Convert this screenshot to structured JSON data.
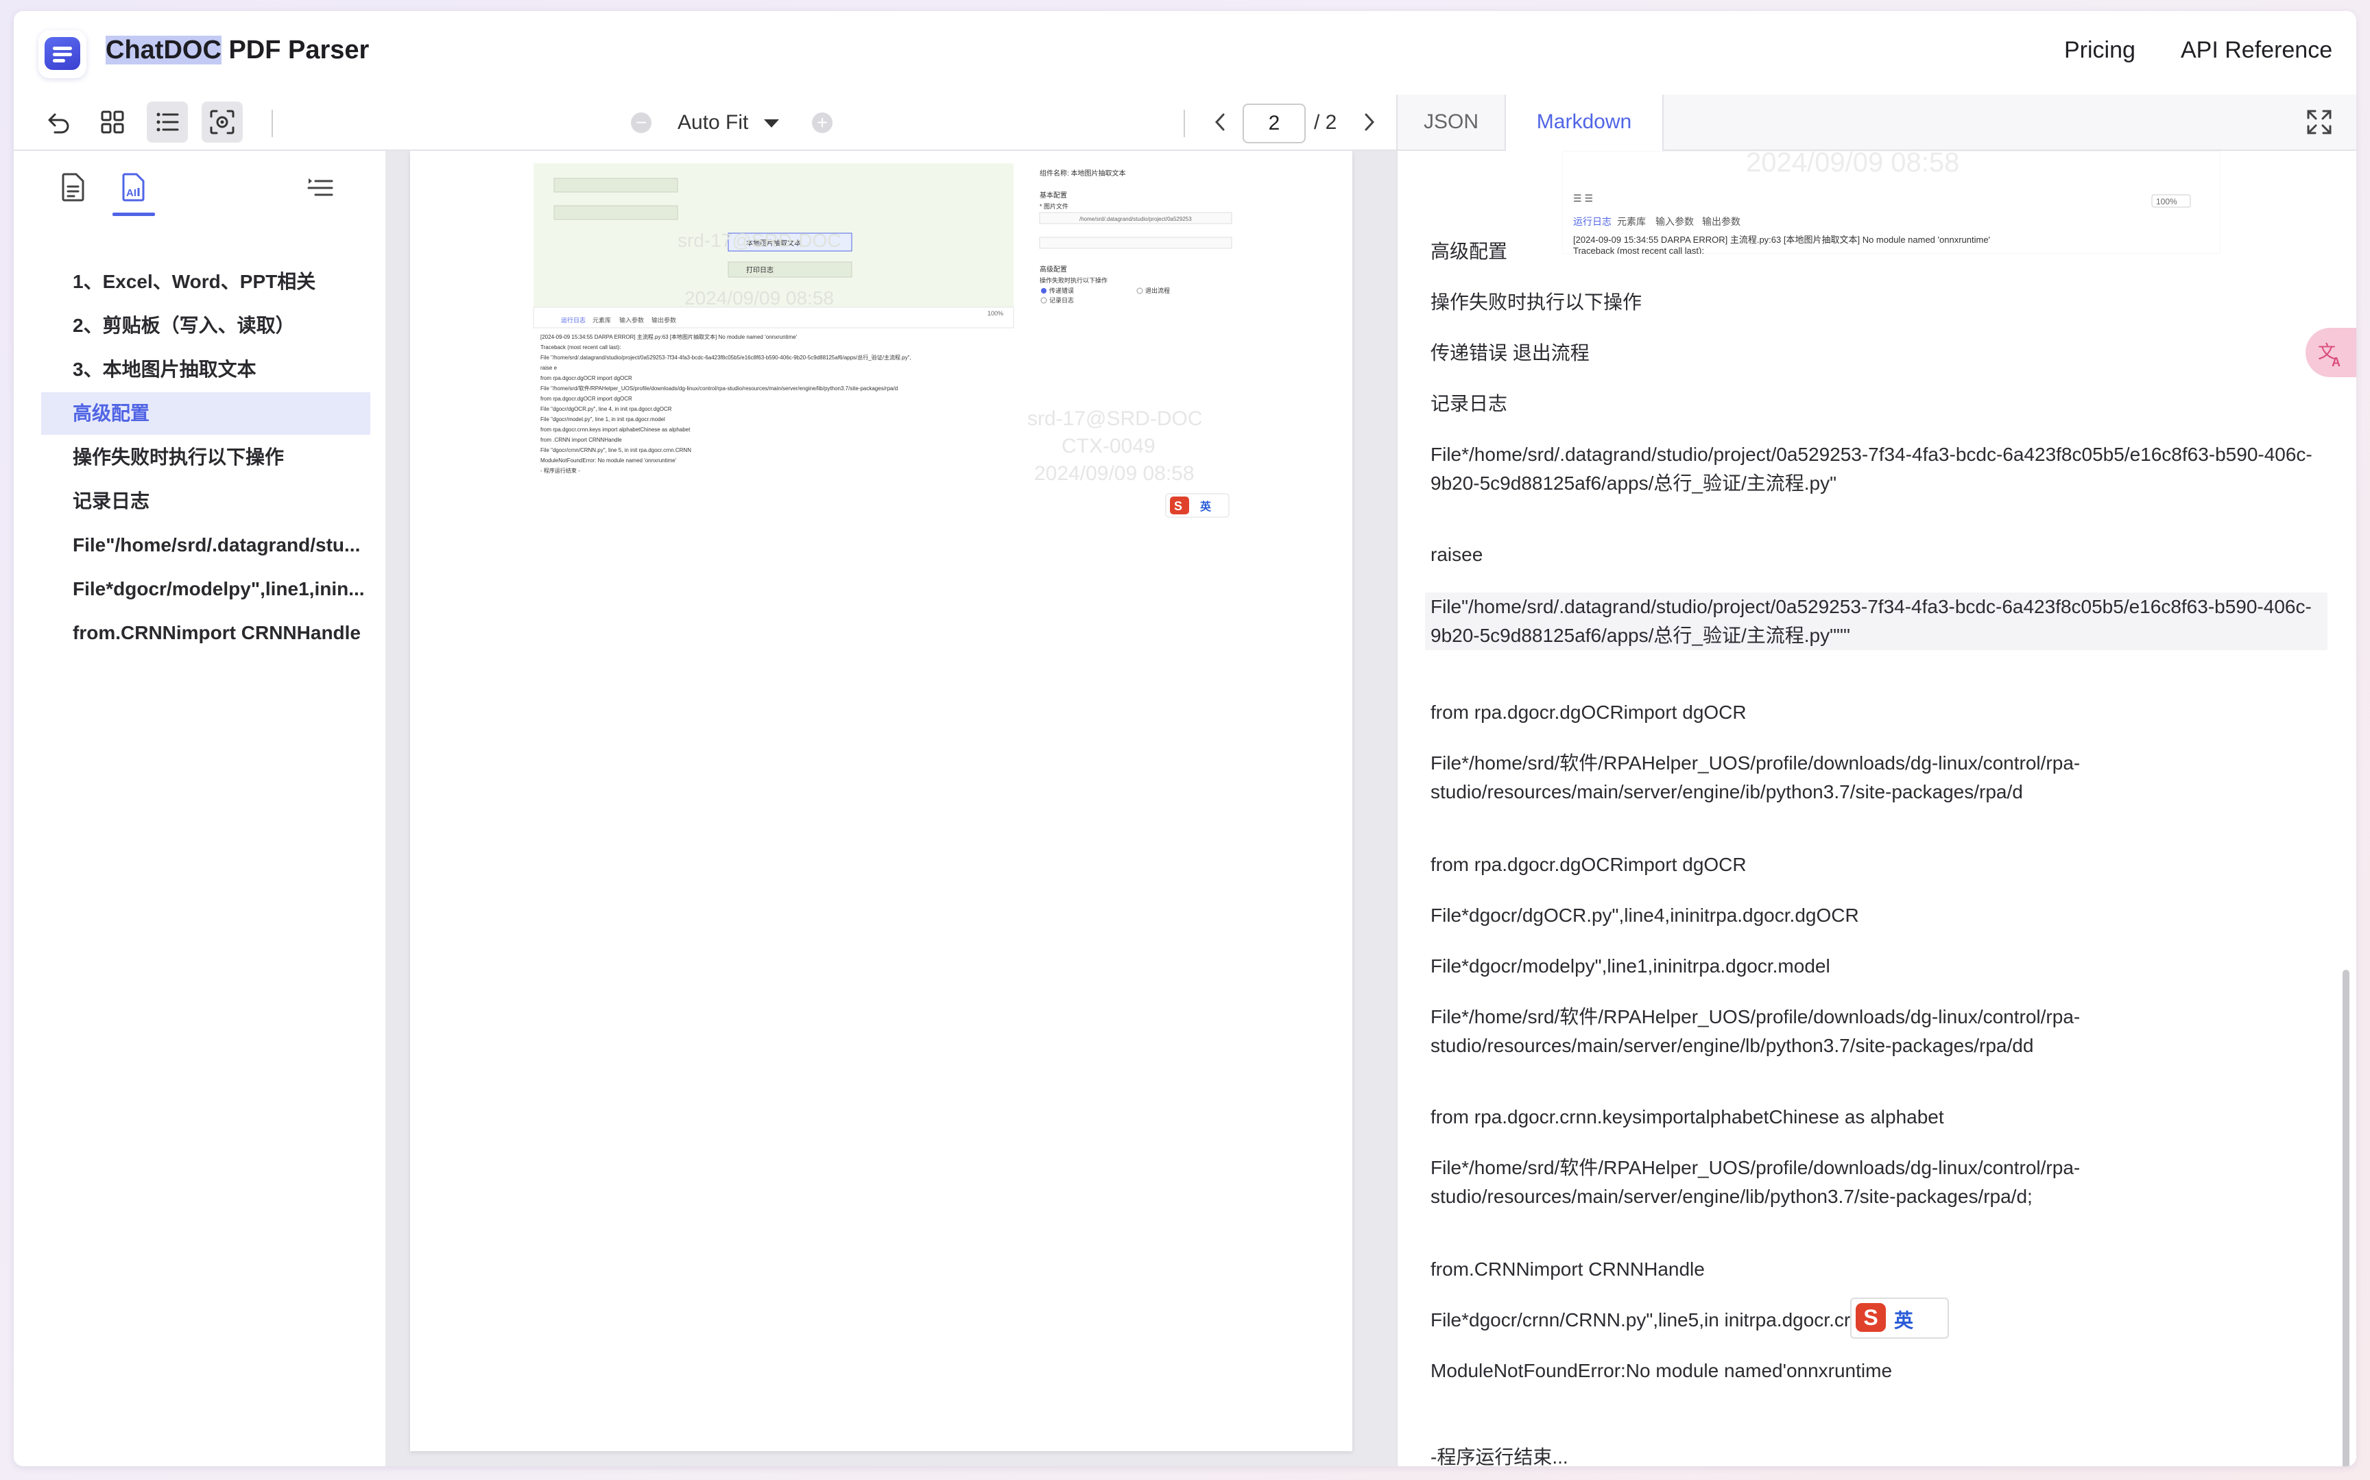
{
  "header": {
    "brand_highlight": "ChatDOC",
    "brand_rest": " PDF Parser",
    "nav": {
      "pricing": "Pricing",
      "api_reference": "API Reference"
    }
  },
  "toolbar": {
    "zoom_label": "Auto Fit",
    "page_current": "2",
    "page_total": "/ 2"
  },
  "outline": {
    "items": [
      {
        "label": "1、Excel、Word、PPT相关",
        "active": false
      },
      {
        "label": "2、剪贴板（写入、读取）",
        "active": false
      },
      {
        "label": "3、本地图片抽取文本",
        "active": false
      },
      {
        "label": "高级配置",
        "active": true
      },
      {
        "label": "操作失败时执行以下操作",
        "active": false
      },
      {
        "label": "记录日志",
        "active": false
      },
      {
        "label": "File\"/home/srd/.datagrand/stu...",
        "active": false
      },
      {
        "label": "File*dgocr/modelpy\",line1,inin...",
        "active": false
      },
      {
        "label": "from.CRNNimport CRNNHandle",
        "active": false
      }
    ]
  },
  "right_tabs": {
    "json": "JSON",
    "markdown": "Markdown"
  },
  "markdown": {
    "paragraphs": [
      {
        "text": "高级配置"
      },
      {
        "text": "操作失败时执行以下操作"
      },
      {
        "text": "传递错误 退出流程"
      },
      {
        "text": "记录日志"
      },
      {
        "text": "File*/home/srd/.datagrand/studio/project/0a529253-7f34-4fa3-bcdc-6a423f8c05b5/e16c8f63-b590-406c-9b20-5c9d88125af6/apps/总行_验证/主流程.py\""
      },
      {
        "text": "raisee"
      },
      {
        "text": "File\"/home/srd/.datagrand/studio/project/0a529253-7f34-4fa3-bcdc-6a423f8c05b5/e16c8f63-b590-406c-9b20-5c9d88125af6/apps/总行_验证/主流程.py\"\"\""
      },
      {
        "text": "from rpa.dgocr.dgOCRimport dgOCR"
      },
      {
        "text": "File*/home/srd/软件/RPAHelper_UOS/profile/downloads/dg-linux/control/rpa-studio/resources/main/server/engine/ib/python3.7/site-packages/rpa/d"
      },
      {
        "text": "from rpa.dgocr.dgOCRimport dgOCR"
      },
      {
        "text": "File*dgocr/dgOCR.py\",line4,ininitrpa.dgocr.dgOCR"
      },
      {
        "text": "File*dgocr/modelpy\",line1,ininitrpa.dgocr.model"
      },
      {
        "text": "File*/home/srd/软件/RPAHelper_UOS/profile/downloads/dg-linux/control/rpa-studio/resources/main/server/engine/lb/python3.7/site-packages/rpa/dd"
      },
      {
        "text": "from rpa.dgocr.crnn.keysimportalphabetChinese as alphabet"
      },
      {
        "text": "File*/home/srd/软件/RPAHelper_UOS/profile/downloads/dg-linux/control/rpa-studio/resources/main/server/engine/lib/python3.7/site-packages/rpa/d;"
      },
      {
        "text": "from.CRNNimport CRNNHandle"
      },
      {
        "text": "File*dgocr/crnn/CRNN.py\",line5,in initrpa.dgocr.crnn.CRNN"
      },
      {
        "text": "ModuleNotFoundError:No module named'onnxruntime"
      },
      {
        "text": "-程序运行结束..."
      }
    ],
    "top_image": {
      "watermark": "2024/09/09 08:58",
      "tabs": [
        "运行日志",
        "元素库",
        "输入参数",
        "输出参数"
      ],
      "zoom": "100%",
      "log_line": "[2024-09-09 15:34:55 DARPA ERROR] 主流程.py:63 [本地图片抽取文本] No module named 'onnxruntime'",
      "traceback": "Traceback (most recent call last):"
    },
    "ime_badge": {
      "logo": "S",
      "label": "英"
    }
  },
  "pdf_page": {
    "panel_title": "组件名称: 本地图片抽取文本",
    "section_basic": "基本配置",
    "field_file": "* 图片文件",
    "field_path": "/home/srd/.datagrand/studio/project/0a529253",
    "section_adv": "高级配置",
    "adv_option": "操作失败时执行以下操作",
    "radio_pass": "传递错误",
    "radio_exit": "退出流程",
    "radio_log": "记录日志",
    "flow_nodes": [
      "本地图片抽取文本",
      "打印日志"
    ],
    "log_tabs": [
      "运行日志",
      "元素库",
      "输入参数",
      "输出参数"
    ],
    "log_lines": [
      "[2024-09-09 15:34:55 DARPA ERROR] 主流程.py:63 [本地图片抽取文本] No module named 'onnxruntime'",
      "Traceback (most recent call last):",
      "File \"/home/srd/.datagrand/studio/project/0a529253-7f34-4fa3-bcdc-6a423f8c05b5/e16c8f63-b590-406c-9b20-5c9d88125af6/apps/总行_验证/主流程.py\",",
      "raise e",
      "from rpa.dgocr.dgOCR import dgOCR",
      "File \"/home/srd/软件/RPAHelper_UOS/profile/downloads/dg-linux/control/rpa-studio/resources/main/server/engine/lib/python3.7/site-packages/rpa/d",
      "from rpa.dgocr.dgOCR import dgOCR",
      "File \"dgocr/dgOCR.py\", line 4, in init rpa.dgocr.dgOCR",
      "File \"dgocr/model.py\", line 1, in init rpa.dgocr.model",
      "from rpa.dgocr.crnn.keys import alphabetChinese as alphabet",
      "from .CRNN import CRNNHandle",
      "File \"dgocr/crnn/CRNN.py\", line 5, in init rpa.dgocr.crnn.CRNN",
      "ModuleNotFoundError: No module named 'onnxruntime'",
      "- 程序运行结束 -"
    ],
    "watermark_a": "srd-17@SRD-DOC",
    "watermark_b": "CTX-0049",
    "watermark_c": "2024/09/09 08:58",
    "zoom": "100%",
    "ime_label": "英"
  },
  "colors": {
    "accent": "#4f64e6",
    "highlight": "#c3cbf4",
    "active_bg": "#e6e9fa"
  }
}
